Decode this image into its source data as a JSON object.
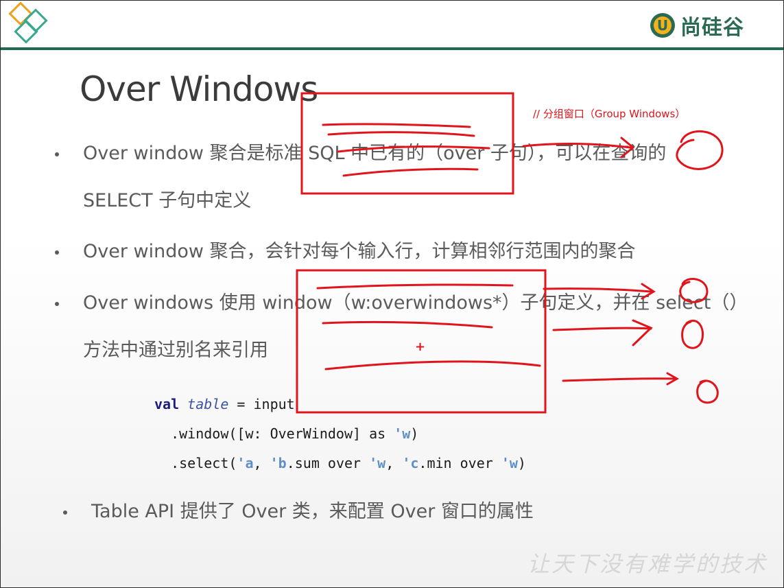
{
  "header": {
    "brand_text": "尚硅谷",
    "brand_mark": "U",
    "brand_color": "#2b6a53",
    "accent_orange": "#f0a020",
    "accent_teal": "#3aa88e"
  },
  "title": "Over Windows",
  "bullets": [
    {
      "line1": "Over window 聚合是标准 SQL 中已有的（over 子句），可以在查询的",
      "line2": "SELECT 子句中定义"
    },
    {
      "line1": "Over window 聚合，会针对每个输入行，计算相邻行范围内的聚合"
    },
    {
      "line1": "Over windows 使用 window（w:overwindows*）子句定义，并在 select（）",
      "line2": "方法中通过别名来引用"
    }
  ],
  "code": {
    "kw_val": "val",
    "var_table": "table",
    "eq_input": " = input",
    "line2": "  .window([w: OverWindow] as ",
    "sym_w": "'w",
    "line2_end": ")",
    "line3_start": "  .select(",
    "sym_a": "'a",
    "comma": ", ",
    "sym_b": "'b",
    "over_text": ".sum over ",
    "sym_c": "'c",
    "min_over": ".min over ",
    "close": ")"
  },
  "bullet4": "Table API 提供了 Over 类，来配置 Over 窗口的属性",
  "annotation": {
    "note": "// 分组窗口（Group Windows）",
    "plus": "+",
    "pen_color": "#e0141a"
  },
  "watermark": "让天下没有难学的技术"
}
